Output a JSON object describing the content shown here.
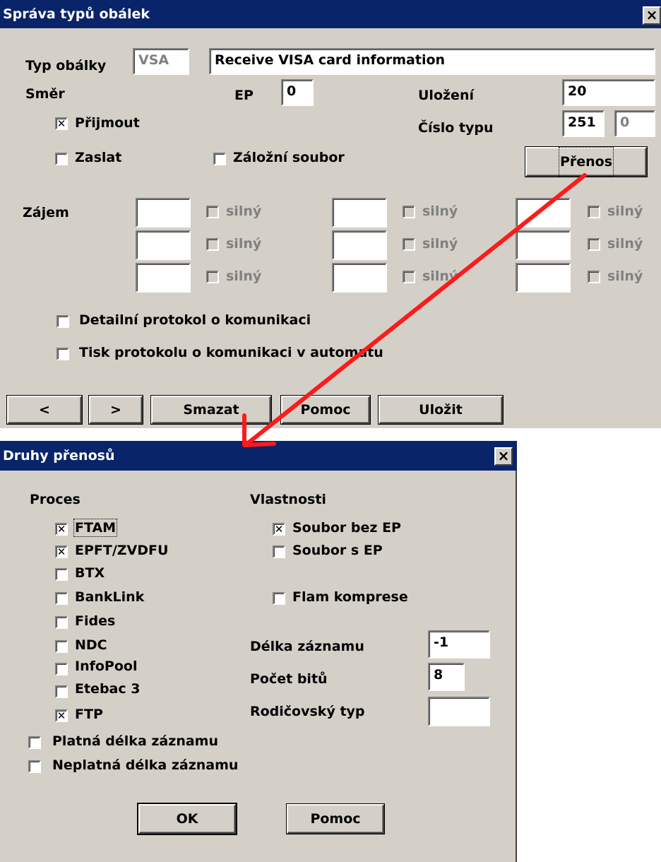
{
  "dialog1": {
    "title": "Správa typů obálek",
    "close": "×",
    "typ_obalky_label": "Typ obálky",
    "typ_obalky_code": "VSA",
    "typ_obalky_desc": "Receive VISA card information",
    "smer_label": "Směr",
    "ep_label": "EP",
    "ep_value": "0",
    "ulozeni_label": "Uložení",
    "ulozeni_value": "20",
    "cislo_typu_label": "Číslo typu",
    "cislo_typu_value": "251",
    "cislo_typu_value2": "0",
    "prijmout_label": "Přijmout",
    "prijmout_checked": true,
    "zaslat_label": "Zaslat",
    "zalozni_label": "Záložní soubor",
    "prenos_button": "Přenos",
    "zajem_label": "Zájem",
    "silny_label": "silný",
    "detailni_label": "Detailní protokol o komunikaci",
    "tisk_label": "Tisk protokolu o komunikaci v automatu",
    "btn_prev": "<",
    "btn_next": ">",
    "btn_smazat": "Smazat",
    "btn_pomoc": "Pomoc",
    "btn_ulozit": "Uložit"
  },
  "dialog2": {
    "title": "Druhy přenosů",
    "close": "×",
    "proces_label": "Proces",
    "vlastnosti_label": "Vlastnosti",
    "processes": [
      {
        "label": "FTAM",
        "checked": true
      },
      {
        "label": "EPFT/ZVDFU",
        "checked": true
      },
      {
        "label": "BTX",
        "checked": false
      },
      {
        "label": "BankLink",
        "checked": false
      },
      {
        "label": "Fides",
        "checked": false
      },
      {
        "label": "NDC",
        "checked": false
      },
      {
        "label": "InfoPool",
        "checked": false
      },
      {
        "label": "Etebac 3",
        "checked": false
      },
      {
        "label": "FTP",
        "checked": true
      }
    ],
    "soubor_bez_ep": "Soubor bez EP",
    "soubor_s_ep": "Soubor s EP",
    "flam": "Flam komprese",
    "delka_label": "Délka záznamu",
    "delka_value": "-1",
    "pocet_label": "Počet bitů",
    "pocet_value": "8",
    "rodic_label": "Rodičovský typ",
    "rodic_value": "",
    "platna": "Platná délka záznamu",
    "neplatna": "Neplatná délka záznamu",
    "btn_ok": "OK",
    "btn_pomoc": "Pomoc"
  },
  "colors": {
    "face": "#d4d0c8",
    "title": "#0a246a",
    "arrow": "#ff1a1a"
  }
}
